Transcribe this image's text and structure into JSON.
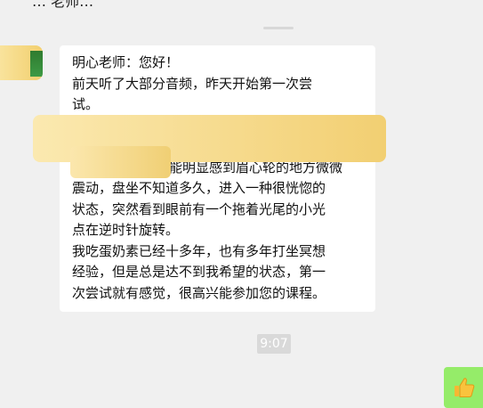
{
  "chat": {
    "header_fragment": "… 老师…",
    "message_lines": [
      "明心老师：您好！",
      "前天听了大部分音频，昨天开始第一次尝",
      "试。",
      "能明显感到眉心轮的地方微微",
      "震动，盘坐不知道多久，进入一种很恍惚的",
      "状态，突然看到眼前有一个拖着光尾的小光",
      "点在逆时针旋转。",
      "我吃蛋奶素已经十多年，也有多年打坐冥想",
      "经验，但是总是达不到我希望的状态，第一",
      "次尝试就有感觉，很高兴能参加您的课程。"
    ],
    "timestamp": "9:07",
    "reply": "👍"
  },
  "colors": {
    "background": "#f0f0f0",
    "bubble": "#ffffff",
    "self_bubble": "#95ec69",
    "redaction": "#f5d77d",
    "time_badge": "#d9d9d9"
  }
}
